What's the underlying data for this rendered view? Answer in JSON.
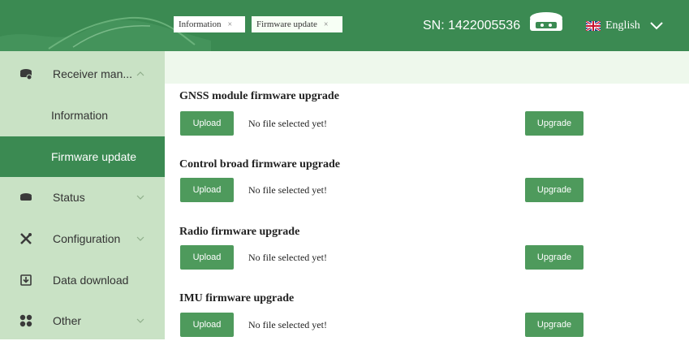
{
  "header": {
    "sn_text": "SN: 1422005536",
    "language": "English",
    "colors": {
      "brand": "#3b8a52",
      "sidebar": "#c9e2c5",
      "button": "#4e9a5c"
    }
  },
  "sidebar": {
    "items": [
      {
        "label": "Receiver man...",
        "icon": "receiver-icon"
      },
      {
        "label": "Information"
      },
      {
        "label": "Firmware update"
      },
      {
        "label": "Status",
        "icon": "status-icon"
      },
      {
        "label": "Configuration",
        "icon": "tools-icon"
      },
      {
        "label": "Data download",
        "icon": "download-icon"
      },
      {
        "label": "Other",
        "icon": "grid-icon"
      }
    ]
  },
  "tabs": [
    {
      "label": "Information",
      "close": "×"
    },
    {
      "label": "Firmware update",
      "close": "×"
    }
  ],
  "sections": [
    {
      "title": "GNSS module firmware upgrade",
      "upload": "Upload",
      "status": "No file selected yet!",
      "upgrade": "Upgrade"
    },
    {
      "title": "Control broad firmware upgrade",
      "upload": "Upload",
      "status": "No file selected yet!",
      "upgrade": "Upgrade"
    },
    {
      "title": "Radio firmware upgrade",
      "upload": "Upload",
      "status": "No file selected yet!",
      "upgrade": "Upgrade"
    },
    {
      "title": "IMU firmware upgrade",
      "upload": "Upload",
      "status": "No file selected yet!",
      "upgrade": "Upgrade"
    }
  ]
}
